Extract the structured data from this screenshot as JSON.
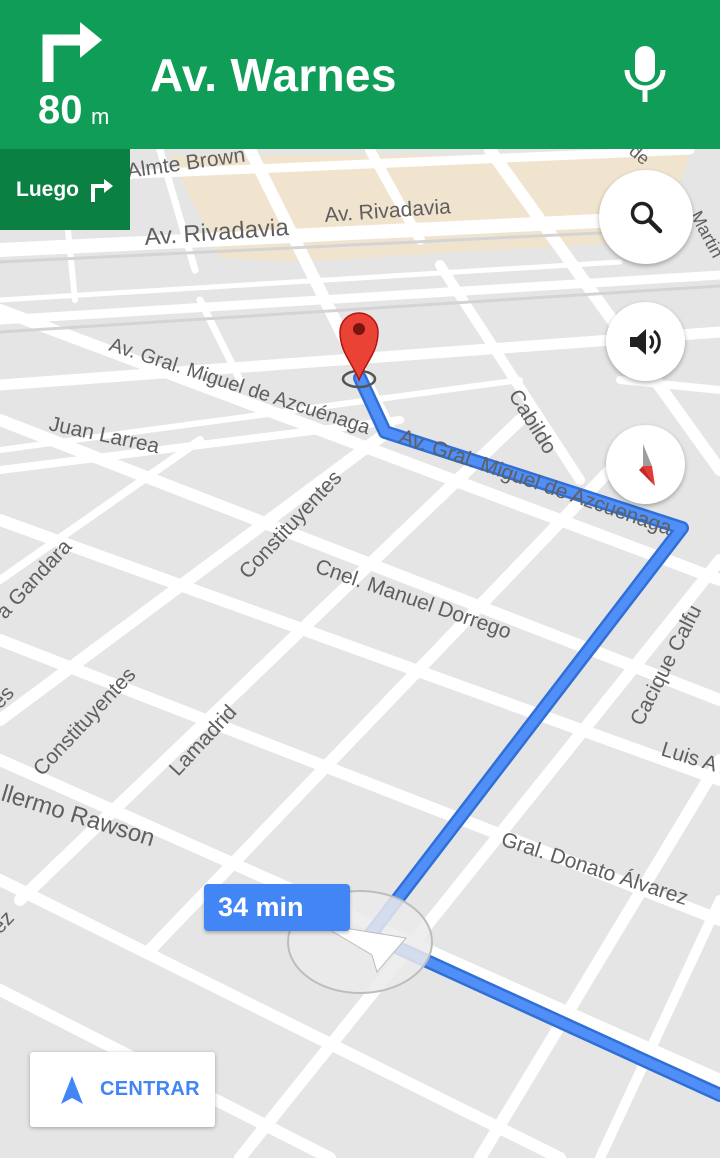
{
  "navigation": {
    "distance_value": "80",
    "distance_unit": "m",
    "street": "Av. Warnes",
    "then_label": "Luego"
  },
  "streets": {
    "almte_brown": "Almte Brown",
    "rivadavia_1": "Av. Rivadavia",
    "rivadavia_2": "Av. Rivadavia",
    "azcuenaga_1": "Av. Gral. Miguel de Azcuénaga",
    "azcuenaga_2": "Av. Gral. Miguel de Azcuenaga",
    "juan_larrea": "Juan Larrea",
    "constituyentes_1": "Constituyentes",
    "constituyentes_2": "Constituyentes",
    "cabildo": "Cabildo",
    "gandara": "a Gandara",
    "dorrego": "Cnel. Manuel Dorrego",
    "lamadrid": "Lamadrid",
    "cacique": "Cacique Calfu",
    "luis": "Luis A",
    "rawson": "llermo Rawson",
    "donato": "Gral. Donato Álvarez",
    "martin": "Martin",
    "de": "de",
    "es": "es",
    "ez": "ez"
  },
  "eta": {
    "label": "34 min"
  },
  "center_button": {
    "label": "CENTRAR"
  },
  "icons": {
    "turn": "turn-right-icon",
    "mic": "mic-icon",
    "search": "search-icon",
    "sound": "volume-icon",
    "compass": "compass-icon",
    "navigation": "navigation-arrow-icon",
    "destination": "destination-pin-icon"
  },
  "colors": {
    "header_bg": "#0f9d58",
    "then_bg": "#0b8043",
    "route": "#4285f4",
    "pin": "#ea4335"
  }
}
